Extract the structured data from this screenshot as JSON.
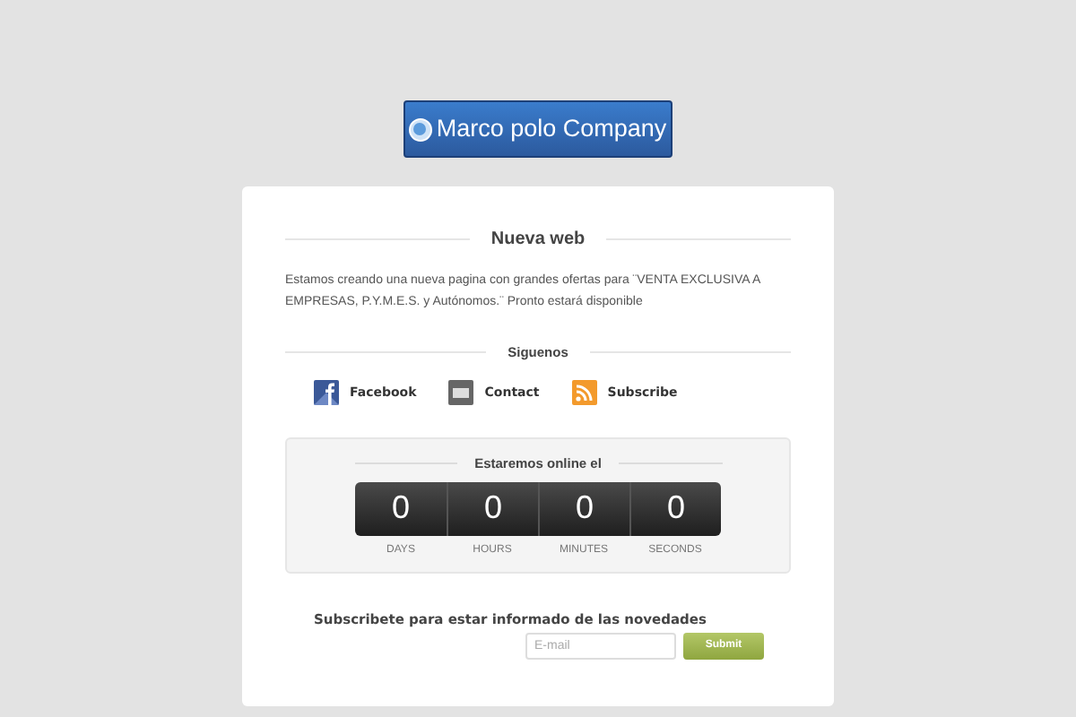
{
  "logo": {
    "text": "Marco polo Company"
  },
  "intro": {
    "title": "Nueva web",
    "text": "Estamos creando una nueva pagina con grandes ofertas para ¨VENTA EXCLUSIVA A EMPRESAS, P.Y.M.E.S. y Autónomos.¨ Pronto estará disponible"
  },
  "social": {
    "title": "Siguenos",
    "links": [
      {
        "kind": "facebook",
        "label": "Facebook"
      },
      {
        "kind": "contact",
        "label": "Contact"
      },
      {
        "kind": "rss",
        "label": "Subscribe"
      }
    ]
  },
  "countdown": {
    "title": "Estaremos online el",
    "units": [
      {
        "value": "0",
        "label": "DAYS"
      },
      {
        "value": "0",
        "label": "HOURS"
      },
      {
        "value": "0",
        "label": "MINUTES"
      },
      {
        "value": "0",
        "label": "SECONDS"
      }
    ]
  },
  "subscribe": {
    "title": "Subscribete para estar informado de las novedades",
    "placeholder": "E-mail",
    "button": "Submit"
  }
}
